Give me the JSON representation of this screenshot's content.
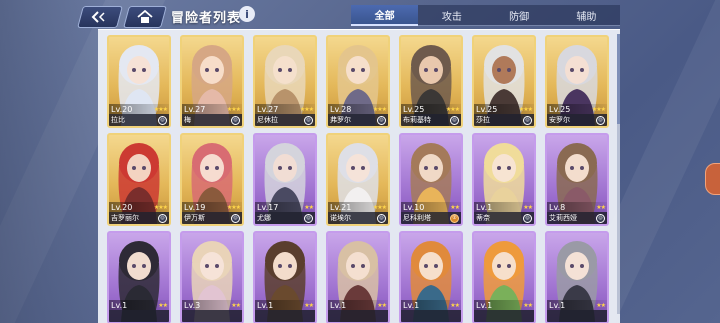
{
  "header": {
    "title": "冒险者列表",
    "info_glyph": "i"
  },
  "tabs": [
    {
      "label": "全部",
      "active": true
    },
    {
      "label": "攻击",
      "active": false
    },
    {
      "label": "防御",
      "active": false
    },
    {
      "label": "辅助",
      "active": false
    }
  ],
  "cards": [
    {
      "name": "拉比",
      "level": "Lv.20",
      "stars": "★★★",
      "frame": "gold",
      "hair": "#e4e8f2",
      "skin": "#f6e2d6",
      "cloth": "#dfe6f3",
      "role_glyph": "◎"
    },
    {
      "name": "梅",
      "level": "Lv.27",
      "stars": "★★★",
      "frame": "gold",
      "hair": "#d6a784",
      "skin": "#f7ddc9",
      "cloth": "#e5b9a8",
      "role_glyph": "◎"
    },
    {
      "name": "尼休拉",
      "level": "Lv.27",
      "stars": "★★★",
      "frame": "gold",
      "hair": "#e9d7b8",
      "skin": "#f5e0cc",
      "cloth": "#b8936b",
      "role_glyph": "◎"
    },
    {
      "name": "弗罗尔",
      "level": "Lv.28",
      "stars": "★★★",
      "frame": "gold",
      "hair": "#e4c58c",
      "skin": "#f6dfcb",
      "cloth": "#6f6a88",
      "role_glyph": "◎"
    },
    {
      "name": "布莉基特",
      "level": "Lv.25",
      "stars": "★★★",
      "frame": "gold",
      "hair": "#6e5a4c",
      "skin": "#e9c8ad",
      "cloth": "#3b3836",
      "role_glyph": "◎"
    },
    {
      "name": "莎拉",
      "level": "Lv.25",
      "stars": "★★★",
      "frame": "gold",
      "hair": "#e2e2e2",
      "skin": "#b07a5a",
      "cloth": "#4a3a36",
      "role_glyph": "◎"
    },
    {
      "name": "安罗尔",
      "level": "Lv.25",
      "stars": "★★★",
      "frame": "gold",
      "hair": "#d8d8de",
      "skin": "#f4dfd3",
      "cloth": "#4a3560",
      "role_glyph": "◎"
    },
    {
      "name": "吉罗丽尔",
      "level": "Lv.20",
      "stars": "★★★",
      "frame": "gold",
      "hair": "#cc3a32",
      "skin": "#f3d3c1",
      "cloth": "#7a2e2c",
      "role_glyph": "◎"
    },
    {
      "name": "伊万斯",
      "level": "Lv.19",
      "stars": "★★★",
      "frame": "gold",
      "hair": "#d86c72",
      "skin": "#f6dcd0",
      "cloth": "#8a5a3c",
      "role_glyph": "◎"
    },
    {
      "name": "尤娜",
      "level": "Lv.17",
      "stars": "★★",
      "frame": "purple",
      "hair": "#d4d4dc",
      "skin": "#f1ddd4",
      "cloth": "#4a4a62",
      "role_glyph": "◎"
    },
    {
      "name": "诺埃尔",
      "level": "Lv.21",
      "stars": "★★★",
      "frame": "gold",
      "hair": "#dedfe6",
      "skin": "#f5e3d9",
      "cloth": "#f2f0f0",
      "role_glyph": "◎"
    },
    {
      "name": "尼科利塔",
      "level": "Lv.10",
      "stars": "★★",
      "frame": "purple",
      "hair": "#a47a5a",
      "skin": "#f0d9c6",
      "cloth": "#e9b45a",
      "role_glyph": "②"
    },
    {
      "name": "蒂奈",
      "level": "Lv.1",
      "stars": "★★",
      "frame": "purple",
      "hair": "#f0dc9a",
      "skin": "#f7e4d2",
      "cloth": "#e9d29c",
      "role_glyph": "◎"
    },
    {
      "name": "艾莉西娅",
      "level": "Lv.8",
      "stars": "★★",
      "frame": "purple",
      "hair": "#8a6a52",
      "skin": "#f3ddcd",
      "cloth": "#8a5a68",
      "role_glyph": "◎"
    },
    {
      "name": "",
      "level": "Lv.1",
      "stars": "★★",
      "frame": "purple",
      "hair": "#2e2a36",
      "skin": "#f1dccf",
      "cloth": "#2a2a34",
      "role_glyph": ""
    },
    {
      "name": "",
      "level": "Lv.3",
      "stars": "★★",
      "frame": "purple",
      "hair": "#e9d3b8",
      "skin": "#f6e3d8",
      "cloth": "#e2c4d2",
      "role_glyph": ""
    },
    {
      "name": "",
      "level": "Lv.1",
      "stars": "★★",
      "frame": "purple",
      "hair": "#5a3e2e",
      "skin": "#f3dccb",
      "cloth": "#6a4a2e",
      "role_glyph": ""
    },
    {
      "name": "",
      "level": "Lv.1",
      "stars": "★★",
      "frame": "purple",
      "hair": "#d8c0a4",
      "skin": "#f4dfd0",
      "cloth": "#6a3a3a",
      "role_glyph": ""
    },
    {
      "name": "",
      "level": "Lv.1",
      "stars": "★★",
      "frame": "purple",
      "hair": "#e08a3c",
      "skin": "#f6dfcb",
      "cloth": "#3a6a8a",
      "role_glyph": ""
    },
    {
      "name": "",
      "level": "Lv.1",
      "stars": "★★",
      "frame": "purple",
      "hair": "#ee9a3c",
      "skin": "#f6dfcb",
      "cloth": "#7ab05a",
      "role_glyph": ""
    },
    {
      "name": "",
      "level": "Lv.1",
      "stars": "★★",
      "frame": "purple",
      "hair": "#9a9aa6",
      "skin": "#f4e1d6",
      "cloth": "#3a3a48",
      "role_glyph": ""
    }
  ]
}
